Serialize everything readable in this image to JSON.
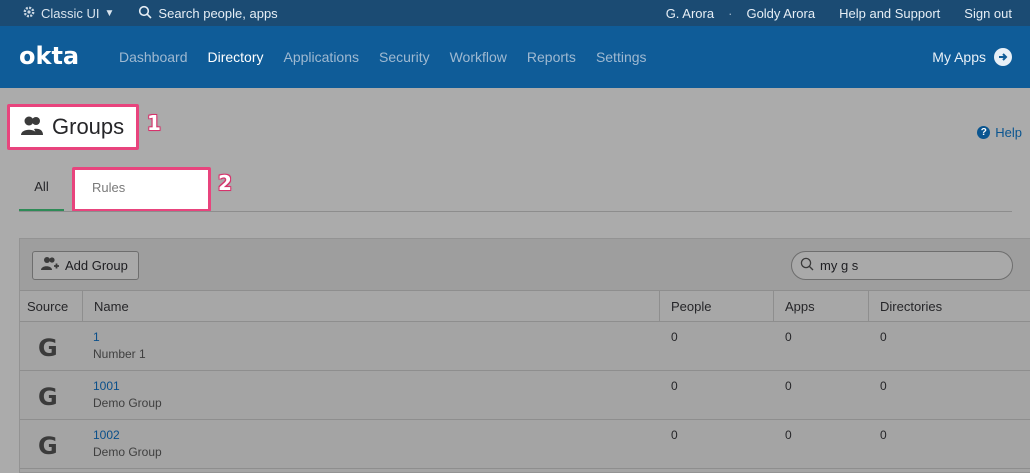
{
  "topbar": {
    "classic_ui": "Classic UI",
    "search": "Search people, apps",
    "user_short": "G. Arora",
    "separator": "·",
    "user_full": "Goldy Arora",
    "help_support": "Help and Support",
    "sign_out": "Sign out"
  },
  "nav": {
    "logo": "okta",
    "items": [
      "Dashboard",
      "Directory",
      "Applications",
      "Security",
      "Workflow",
      "Reports",
      "Settings"
    ],
    "active": "Directory",
    "my_apps": "My Apps"
  },
  "page": {
    "title": "Groups",
    "help": "Help",
    "callout_1": "1",
    "callout_2": "2"
  },
  "tabs": {
    "all": "All",
    "rules": "Rules"
  },
  "toolbar": {
    "add_group": "Add Group",
    "search_value": "my g s"
  },
  "table": {
    "headers": [
      "Source",
      "Name",
      "People",
      "Apps",
      "Directories"
    ],
    "rows": [
      {
        "source": "G",
        "name": "1",
        "description": "Number 1",
        "people": "0",
        "apps": "0",
        "directories": "0"
      },
      {
        "source": "G",
        "name": "1001",
        "description": "Demo Group",
        "people": "0",
        "apps": "0",
        "directories": "0"
      },
      {
        "source": "G",
        "name": "1002",
        "description": "Demo Group",
        "people": "0",
        "apps": "0",
        "directories": "0"
      }
    ]
  },
  "colors": {
    "topbar": "#1b4b73",
    "navbar": "#0f5c98",
    "highlight": "#e8447d",
    "active_tab": "#2e8b57",
    "link": "#0a4f8a"
  }
}
